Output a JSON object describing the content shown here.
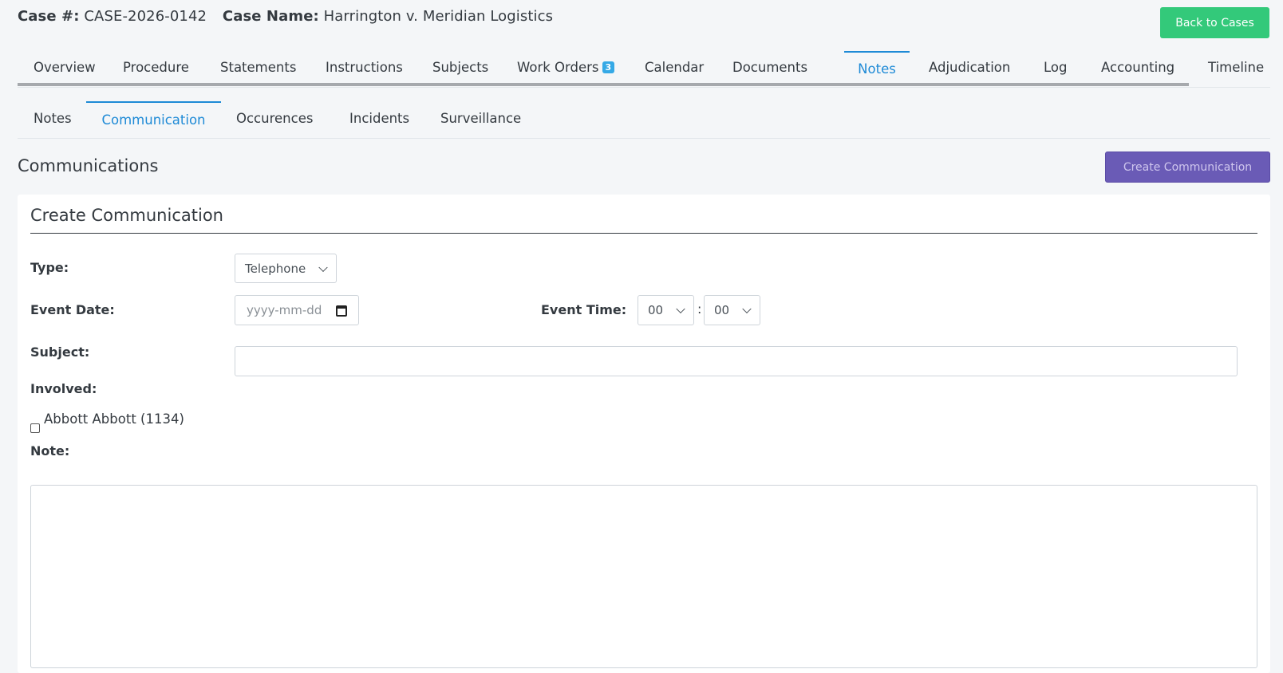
{
  "header": {
    "case_number_label": "Case #:",
    "case_number": "CASE-2026-0142",
    "case_name_label": "Case Name:",
    "case_name": "Harrington v. Meridian Logistics",
    "back_button": "Back to Cases"
  },
  "main_tabs": [
    {
      "label": "Overview"
    },
    {
      "label": "Procedure"
    },
    {
      "label": "Statements"
    },
    {
      "label": "Instructions"
    },
    {
      "label": "Subjects"
    },
    {
      "label": "Work Orders",
      "badge": "3"
    },
    {
      "label": "Calendar"
    },
    {
      "label": "Documents"
    },
    {
      "label": "Notes",
      "active": true
    },
    {
      "label": "Adjudication"
    },
    {
      "label": "Log"
    },
    {
      "label": "Accounting"
    },
    {
      "label": "Timeline"
    }
  ],
  "sub_tabs": [
    {
      "label": "Notes"
    },
    {
      "label": "Communication",
      "active": true
    },
    {
      "label": "Occurences"
    },
    {
      "label": "Incidents"
    },
    {
      "label": "Surveillance"
    }
  ],
  "section": {
    "title": "Communications",
    "create_button": "Create Communication"
  },
  "form": {
    "title": "Create Communication",
    "type_label": "Type:",
    "type_value": "Telephone",
    "event_date_label": "Event Date:",
    "event_date_placeholder": "yyyy-mm-dd",
    "event_time_label": "Event Time:",
    "hour_value": "00",
    "minute_value": "00",
    "time_separator": ":",
    "subject_label": "Subject:",
    "subject_value": "",
    "involved_label": "Involved:",
    "involved": [
      {
        "label": "Abbott Abbott (1134)",
        "checked": false
      }
    ],
    "note_label": "Note:",
    "note_value": ""
  },
  "colors": {
    "accent": "#1e8ad6",
    "back_button": "#33c97a",
    "create_button": "#6a5bb6",
    "badge": "#35a9e6"
  }
}
